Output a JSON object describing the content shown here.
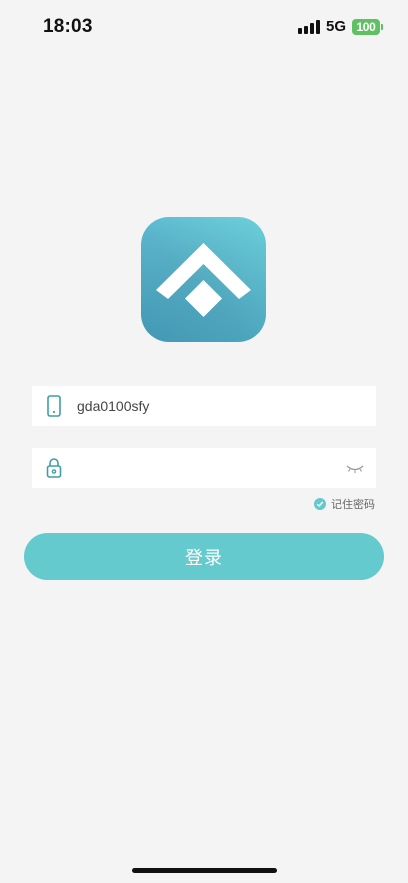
{
  "status_bar": {
    "time": "18:03",
    "network": "5G",
    "battery": "100"
  },
  "icons": {
    "signal": "signal-bars-icon",
    "battery": "battery-icon",
    "account": "phone-icon",
    "password": "lock-icon",
    "visibility": "eye-closed-icon",
    "check": "check-circle-icon"
  },
  "login_form": {
    "account_value": "gda0100sfy",
    "password_value": "",
    "remember_label": "记住密码",
    "remember_checked": true,
    "submit_label": "登录"
  },
  "colors": {
    "accent": "#64cacd",
    "background": "#f4f4f4",
    "logo_gradient_start": "#74e4ee",
    "logo_gradient_end": "#4a9fbf"
  }
}
